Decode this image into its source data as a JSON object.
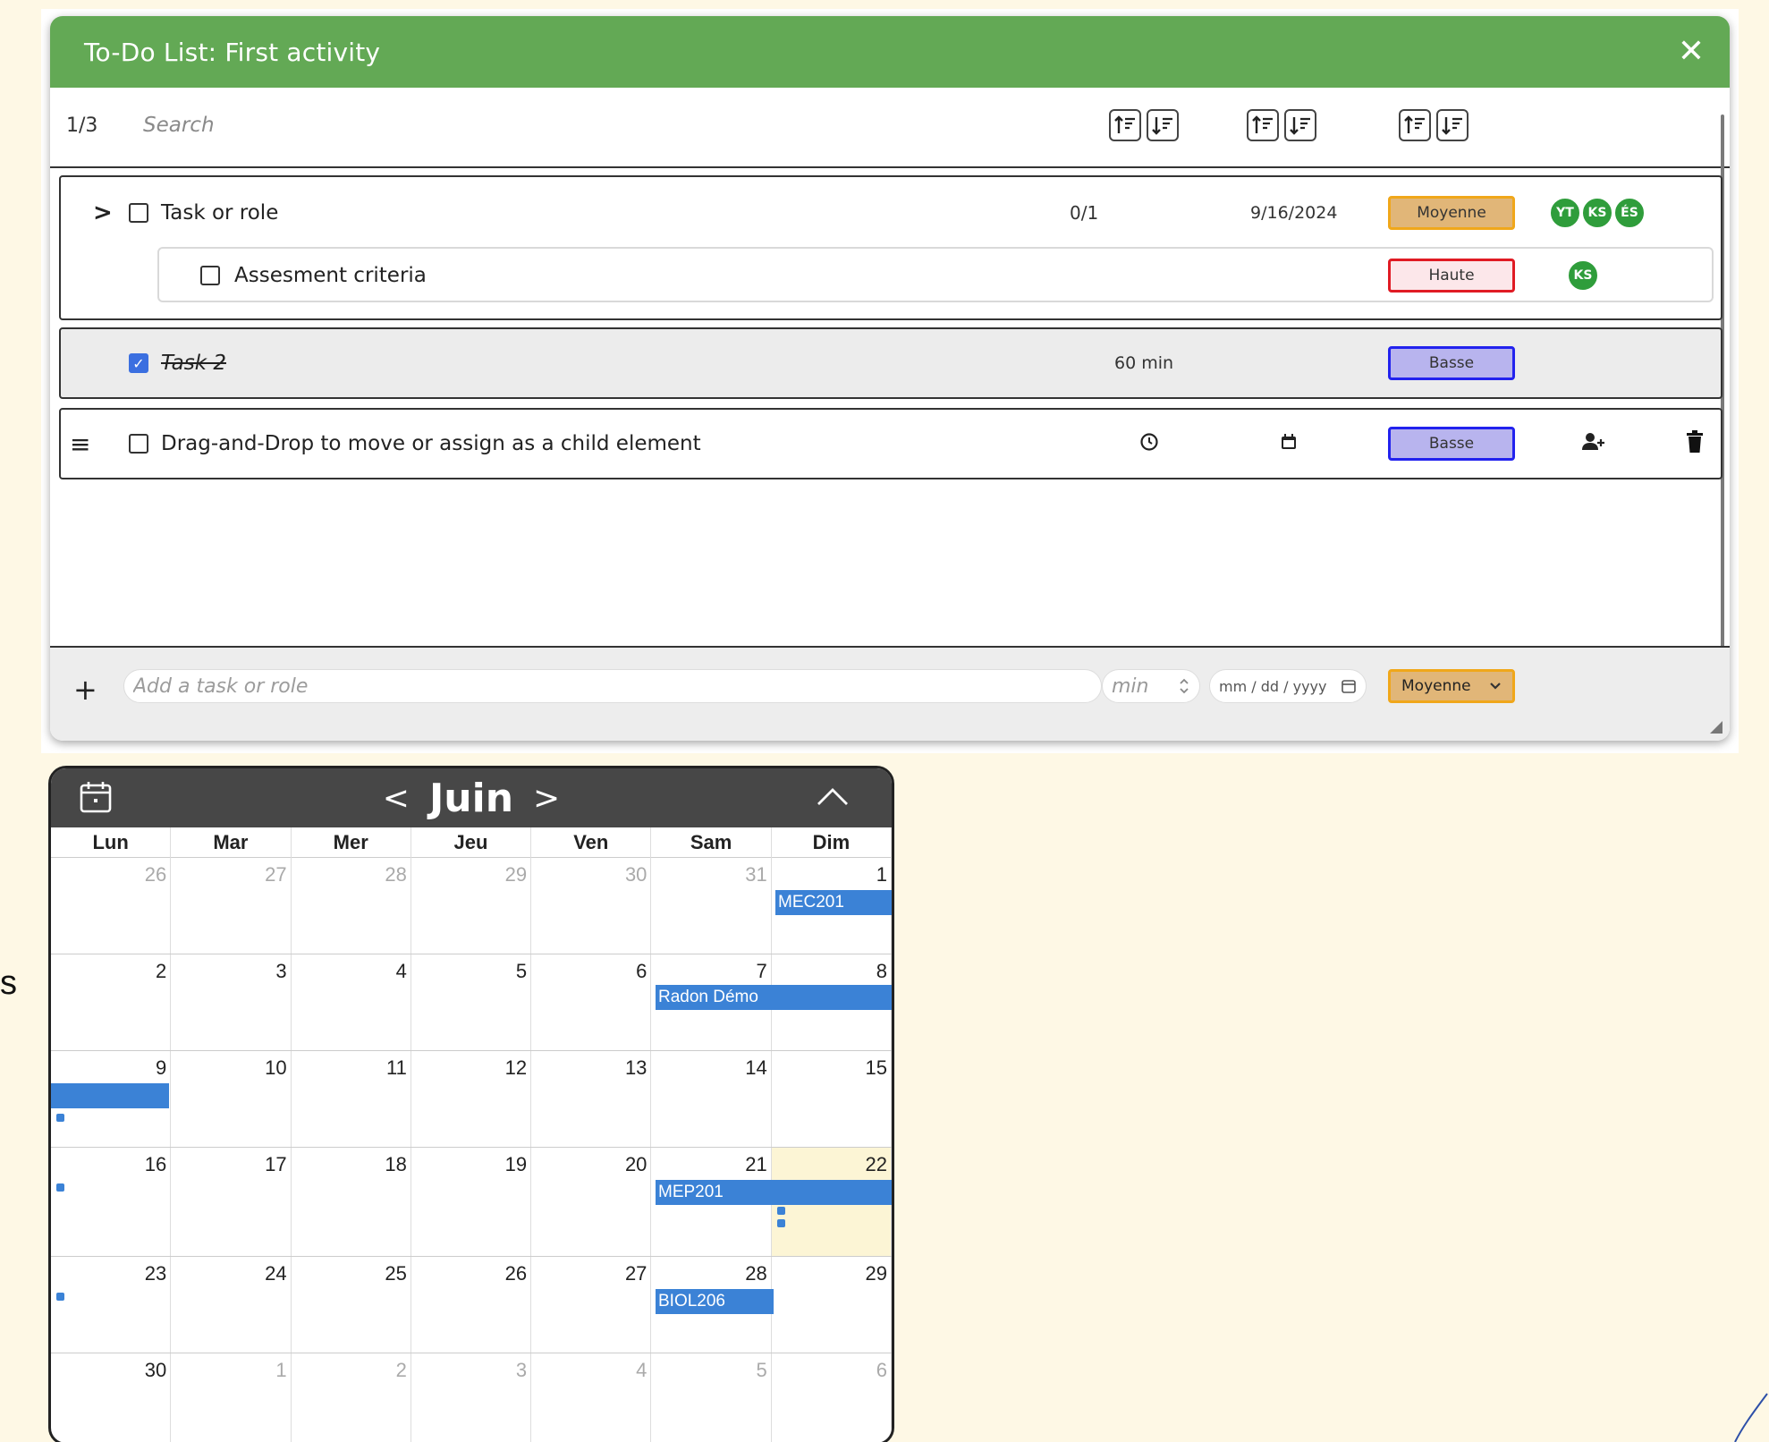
{
  "todo": {
    "title": "To-Do List: First activity",
    "page_count": "1/3",
    "search_placeholder": "Search",
    "tasks": [
      {
        "label": "Task or role",
        "progress": "0/1",
        "date": "9/16/2024",
        "priority": "Moyenne",
        "avatars": [
          "YT",
          "KS",
          "ÉS"
        ],
        "children": [
          {
            "label": "Assesment criteria",
            "priority": "Haute",
            "avatars": [
              "KS"
            ]
          }
        ]
      },
      {
        "label": "Task 2",
        "checked": true,
        "duration": "60 min",
        "priority": "Basse"
      },
      {
        "label": "Drag-and-Drop to move or assign as a child element",
        "priority": "Basse"
      }
    ],
    "footer": {
      "add_placeholder": "Add a task or role",
      "min_placeholder": "min",
      "date_placeholder": "mm / dd / yyyy",
      "priority_selected": "Moyenne"
    }
  },
  "calendar": {
    "month": "Juin",
    "weekdays": [
      "Lun",
      "Mar",
      "Mer",
      "Jeu",
      "Ven",
      "Sam",
      "Dim"
    ],
    "weeks": [
      [
        "26",
        "27",
        "28",
        "29",
        "30",
        "31",
        "1"
      ],
      [
        "2",
        "3",
        "4",
        "5",
        "6",
        "7",
        "8"
      ],
      [
        "9",
        "10",
        "11",
        "12",
        "13",
        "14",
        "15"
      ],
      [
        "16",
        "17",
        "18",
        "19",
        "20",
        "21",
        "22"
      ],
      [
        "23",
        "24",
        "25",
        "26",
        "27",
        "28",
        "29"
      ],
      [
        "30",
        "1",
        "2",
        "3",
        "4",
        "5",
        "6"
      ]
    ],
    "events": [
      {
        "label": "MEC201"
      },
      {
        "label": "Radon Démo"
      },
      {
        "label": ""
      },
      {
        "label": "MEP201"
      },
      {
        "label": "BIOL206"
      }
    ]
  },
  "side_text": "s",
  "colors": {
    "header_green": "#63a955",
    "priority_moyenne": "#f0a71a",
    "priority_haute": "#e01b24",
    "priority_basse": "#2222ee",
    "avatar_green": "#2f9d3b",
    "event_blue": "#3b82d6",
    "calendar_header": "#474747"
  }
}
